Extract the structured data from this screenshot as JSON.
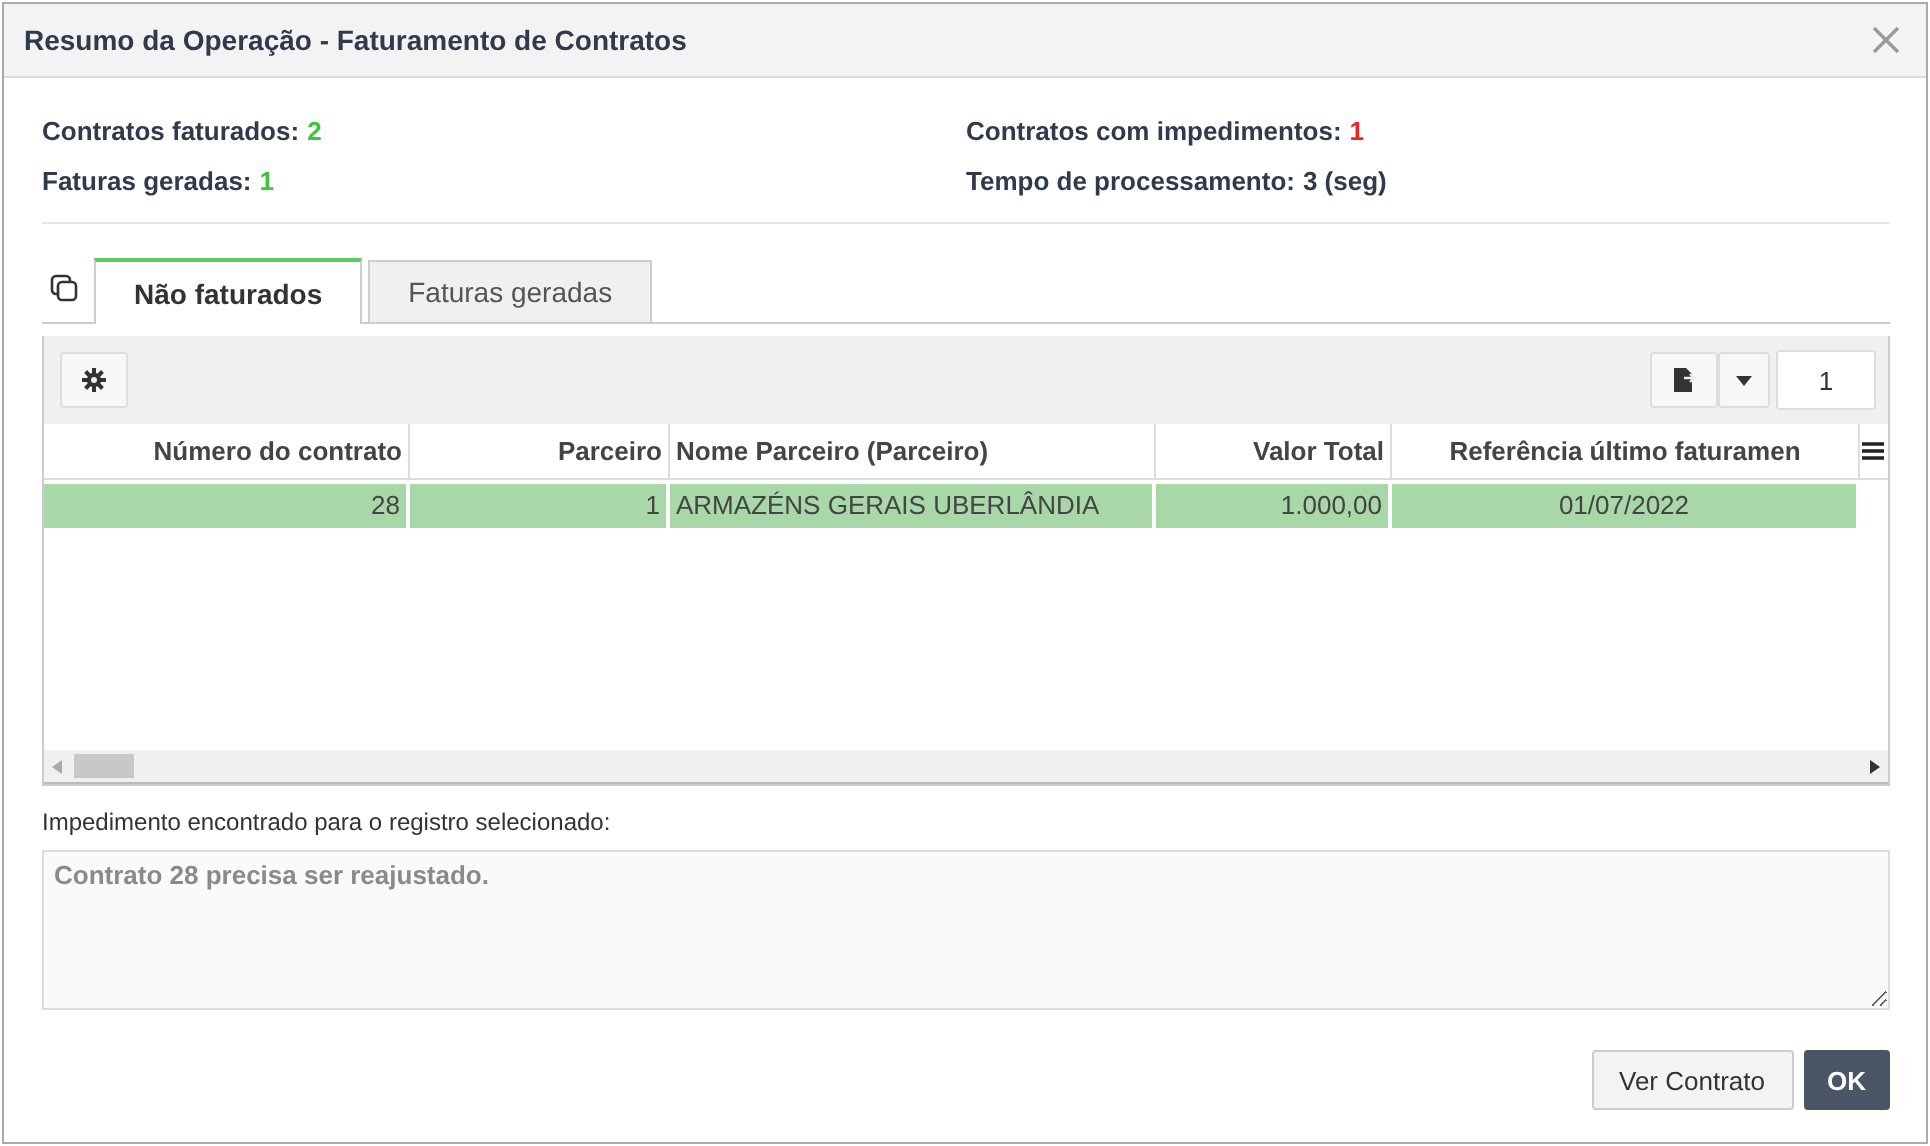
{
  "window": {
    "title": "Resumo da Operação - Faturamento de Contratos"
  },
  "summary": [
    {
      "label": "Contratos faturados:",
      "value": "2",
      "color": "#3cc63c"
    },
    {
      "label": "Contratos com impedimentos:",
      "value": "1",
      "color": "#ee2222"
    },
    {
      "label": "Faturas geradas:",
      "value": "1",
      "color": "#3cc63c"
    },
    {
      "label": "Tempo de processamento:",
      "value": "3 (seg)",
      "color": "#2f3b4c"
    }
  ],
  "tabs": [
    {
      "label": "Não faturados",
      "selected": true
    },
    {
      "label": "Faturas geradas",
      "selected": false
    }
  ],
  "toolbar": {
    "page": "1"
  },
  "table": {
    "columns": [
      "Número do contrato",
      "Parceiro",
      "Nome Parceiro (Parceiro)",
      "Valor Total",
      "Referência último faturamen"
    ],
    "rows": [
      {
        "selected": true,
        "cells": [
          "28",
          "1",
          "ARMAZÉNS GERAIS UBERLÂNDIA",
          "1.000,00",
          "01/07/2022"
        ]
      }
    ]
  },
  "impediment": {
    "label": "Impedimento encontrado para o registro selecionado:",
    "value": "Contrato 28 precisa ser reajustado."
  },
  "buttons": [
    {
      "label": "Ver Contrato",
      "kind": "secondary"
    },
    {
      "label": "OK",
      "kind": "primary"
    }
  ]
}
